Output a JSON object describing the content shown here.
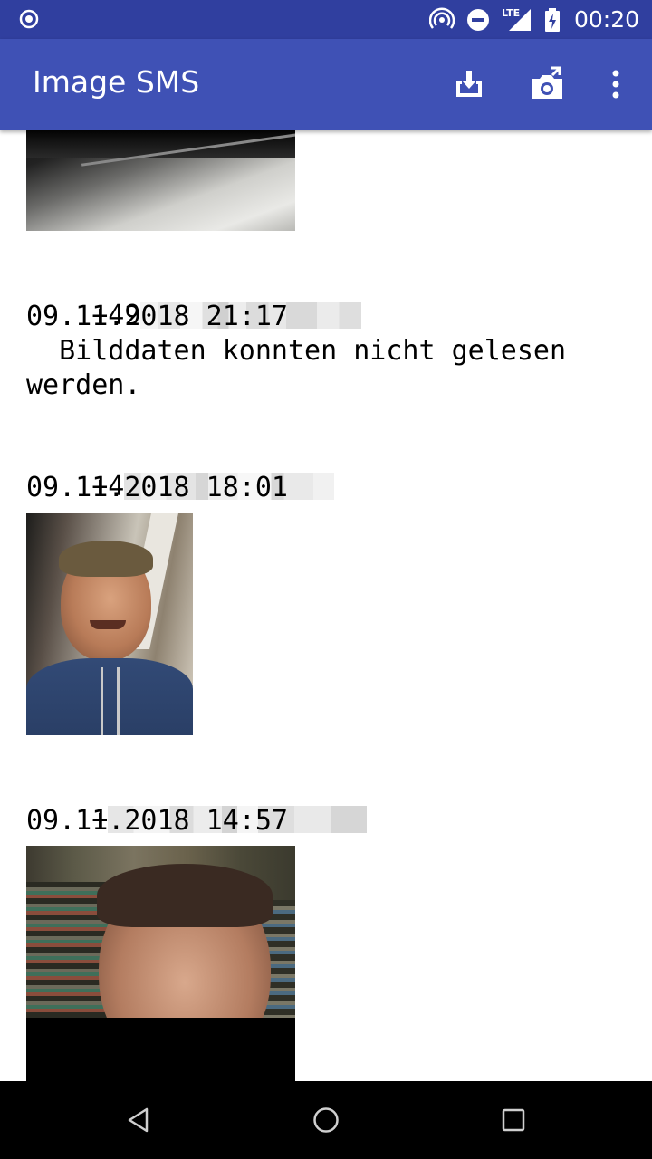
{
  "status_bar": {
    "time": "00:20",
    "network_label": "LTE",
    "icons": [
      "app-notification-icon",
      "hotspot-icon",
      "do-not-disturb-icon",
      "cell-signal-icon",
      "battery-charging-icon"
    ]
  },
  "app_bar": {
    "title": "Image SMS",
    "actions": [
      "import-icon",
      "share-camera-icon",
      "more-vert-icon"
    ],
    "color": "#3F51B5",
    "status_color": "#303F9F"
  },
  "messages": [
    {
      "sender": "+49",
      "sender_obscured": true,
      "date": "09.11.2018 21:17",
      "error": "  Bilddaten konnten nicht gelesen\nwerden."
    },
    {
      "sender": "+4",
      "sender_obscured": true,
      "date": "09.11.2018 18:01",
      "image": "selfie-photo"
    },
    {
      "sender": "+",
      "sender_obscured": true,
      "date": "09.11.2018 14:57",
      "image": "selfie-photo-partial"
    }
  ],
  "nav_bar": {
    "buttons": [
      "back-icon",
      "home-icon",
      "recents-icon"
    ]
  }
}
